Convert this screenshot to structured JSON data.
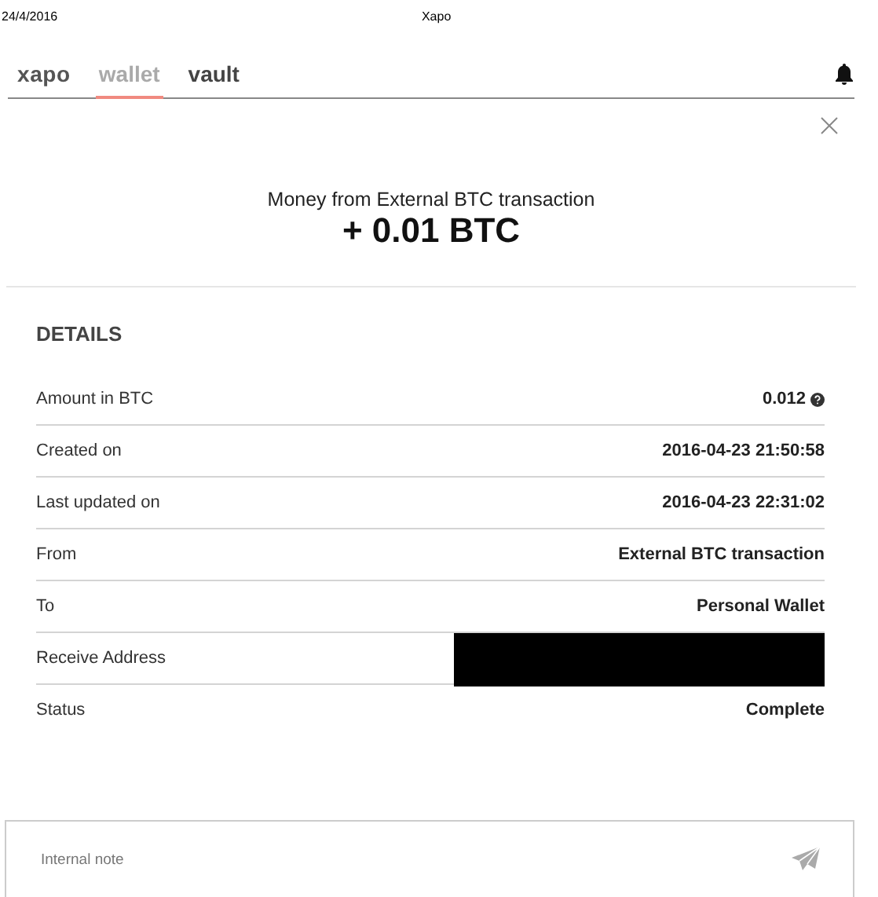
{
  "print_header": {
    "date": "24/4/2016",
    "title": "Xapo"
  },
  "nav": {
    "logo": "xapo",
    "tabs": [
      {
        "label": "wallet",
        "selected": true
      },
      {
        "label": "vault",
        "selected": false
      }
    ]
  },
  "transaction": {
    "title": "Money from External BTC transaction",
    "amount": "+ 0.01 BTC"
  },
  "details": {
    "heading": "DETAILS",
    "rows": [
      {
        "label": "Amount in BTC",
        "kind": "help",
        "value": "0.012"
      },
      {
        "label": "Created on",
        "kind": "text",
        "value": "2016-04-23 21:50:58"
      },
      {
        "label": "Last updated on",
        "kind": "text",
        "value": "2016-04-23 22:31:02"
      },
      {
        "label": "From",
        "kind": "text",
        "value": "External BTC transaction"
      },
      {
        "label": "To",
        "kind": "text",
        "value": "Personal Wallet"
      },
      {
        "label": "Receive Address",
        "kind": "redacted"
      },
      {
        "label": "Status",
        "kind": "text",
        "value": "Complete"
      }
    ]
  },
  "note": {
    "placeholder": "Internal note"
  }
}
